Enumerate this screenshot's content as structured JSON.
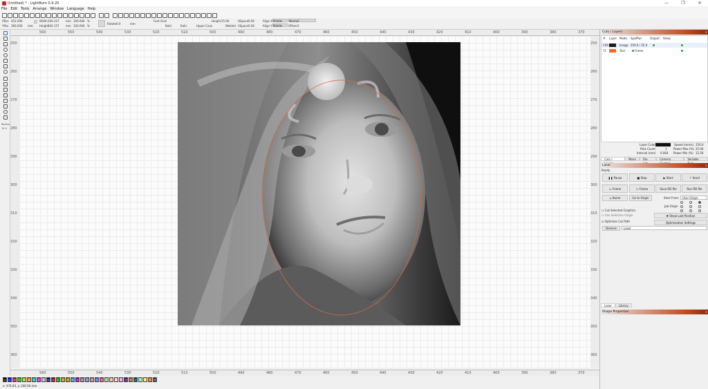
{
  "window": {
    "title": "(Untitled) * - LightBurn 0.9.20",
    "controls": [
      "—",
      "❐",
      "✕"
    ]
  },
  "menu": [
    "File",
    "Edit",
    "Tools",
    "Arrange",
    "Window",
    "Language",
    "Help"
  ],
  "props": {
    "xpos_label": "XPos",
    "xpos_value": "452.000",
    "ypos_label": "YPos",
    "ypos_value": "266.000",
    "width_label": "Width",
    "width_value": "100.157",
    "height_label": "Height",
    "height_value": "100.157",
    "unit_mm": "mm",
    "scale_w": "100.000",
    "scale_h": "100.000",
    "pct": "%",
    "rotate_label": "Rotate",
    "rotate_value": "0.0",
    "rotate_unit": "mm",
    "font_label": "Font",
    "font_value": "Arial",
    "bold": "Bold",
    "italic": "Italic",
    "upper": "Upper Case",
    "welded": "Welded",
    "text_height_label": "Height",
    "text_height_value": "25.00",
    "hspace_label": "HSpace",
    "hspace_value": "0.00",
    "vspace_label": "VSpace",
    "vspace_value": "0.00",
    "alignx_label": "Align X",
    "alignx_value": "Middle",
    "aligny_label": "Align Y",
    "aligny_value": "Middle",
    "normal": "Normal",
    "offset_label": "Offset",
    "offset_value": "0"
  },
  "left_tools": {
    "radius_label": "Radius:",
    "radius_value": "10.0"
  },
  "ruler": {
    "h_labels": [
      "560",
      "550",
      "540",
      "530",
      "520",
      "510",
      "500",
      "490",
      "480",
      "470",
      "460",
      "450",
      "440",
      "430",
      "420",
      "410",
      "400",
      "390",
      "380",
      "370"
    ],
    "v_labels": [
      "250",
      "260",
      "270",
      "280",
      "290",
      "300",
      "310",
      "320",
      "330",
      "340",
      "350",
      "360"
    ]
  },
  "palette": [
    "00",
    "01",
    "02",
    "03",
    "04",
    "05",
    "06",
    "07",
    "08",
    "09",
    "10",
    "11",
    "12",
    "13",
    "14",
    "15",
    "16",
    "17",
    "18",
    "19",
    "20",
    "21",
    "22",
    "23",
    "24",
    "25",
    "26",
    "27",
    "28",
    "29",
    "T1",
    "T2"
  ],
  "palette_colors": [
    "#000000",
    "#0000ff",
    "#ff0000",
    "#00c000",
    "#c0c000",
    "#ff8000",
    "#00c0c0",
    "#ff00ff",
    "#b4b4b4",
    "#0000a0",
    "#a00000",
    "#00a000",
    "#a0a000",
    "#c08000",
    "#00a0ff",
    "#a000a0",
    "#808080",
    "#7d87b9",
    "#bb7784",
    "#4a6fe3",
    "#d33f6a",
    "#8cd78c",
    "#f0b98d",
    "#f6c4e1",
    "#fa9ed4",
    "#500a78",
    "#b45a00",
    "#004754",
    "#86fa88",
    "#ffdb66",
    "#f36b21",
    "#444444"
  ],
  "status": {
    "coords": "x: 476.00, y: 240.00 mm"
  },
  "cuts_panel": {
    "title": "Cuts / Layers",
    "columns": [
      "#",
      "Layer",
      "Mode",
      "Spd/Pwr",
      "Output",
      "Show"
    ],
    "rows": [
      {
        "num": "C00",
        "color": "#1a1a1a",
        "mode": "Image",
        "spdpwr": "250.0 / 25.0"
      },
      {
        "num": "T1",
        "color": "#f36b21",
        "mode": "Tool",
        "spdpwr": "Frame"
      }
    ],
    "layer_color_label": "Layer Color",
    "speed_label": "Speed (mm/s)",
    "speed_value": "250.0",
    "pass_label": "Pass Count",
    "pass_value": "1",
    "pmax_label": "Power Max (%)",
    "pmax_value": "25.00",
    "interval_label": "Interval (mm)",
    "interval_value": "0.064",
    "pmin_label": "Power Min (%)",
    "pmin_value": "12.50",
    "tabs": [
      "Cuts / Layers",
      "Move",
      "File List",
      "Camera Control",
      "Variable Text"
    ]
  },
  "laser_panel": {
    "title": "Laser",
    "status": "Ready",
    "pause": "Pause",
    "stop": "Stop",
    "start": "Start",
    "send": "Send",
    "frame1": "Frame",
    "frame2": "Frame",
    "save_rd": "Save RD file",
    "run_rd": "Run RD file",
    "home": "Home",
    "go_origin": "Go to Origin",
    "start_from_label": "Start From:",
    "start_from_value": "User Origin",
    "cut_selected": "Cut Selected Graphics",
    "use_selection": "Use Selection Origin",
    "optimize": "Optimize Cut Path",
    "job_origin": "Job Origin",
    "show_last": "Show Last Position",
    "opt_settings": "Optimization Settings",
    "devices": "Devices",
    "device_value": "Laser",
    "tabs": [
      "Laser",
      "Library"
    ]
  },
  "shape_panel": {
    "title": "Shape Properties"
  }
}
